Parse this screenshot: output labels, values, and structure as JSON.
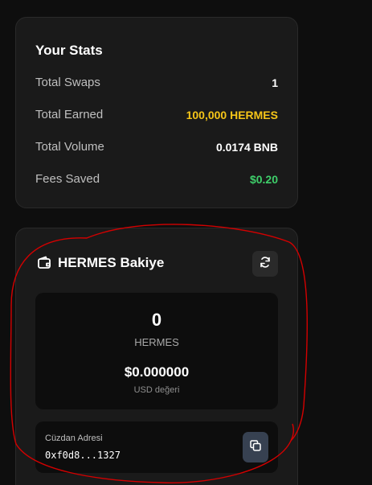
{
  "stats": {
    "title": "Your Stats",
    "rows": [
      {
        "label": "Total Swaps",
        "value": "1",
        "color": "#ffffff"
      },
      {
        "label": "Total Earned",
        "value": "100,000 HERMES",
        "color": "#f5c518"
      },
      {
        "label": "Total Volume",
        "value": "0.0174 BNB",
        "color": "#ffffff"
      },
      {
        "label": "Fees Saved",
        "value": "$0.20",
        "color": "#3ecf6a"
      }
    ]
  },
  "balance": {
    "title": "HERMES Bakiye",
    "amount": "0",
    "unit": "HERMES",
    "usd_value": "$0.000000",
    "usd_label": "USD değeri",
    "icons": {
      "wallet": "wallet-icon",
      "refresh": "refresh-icon",
      "copy": "copy-icon"
    }
  },
  "wallet": {
    "label": "Cüzdan Adresi",
    "address": "0xf0d8...1327"
  },
  "colors": {
    "accent_gold": "#f5c518",
    "accent_green": "#3ecf6a",
    "annotation_red": "#d40000"
  }
}
